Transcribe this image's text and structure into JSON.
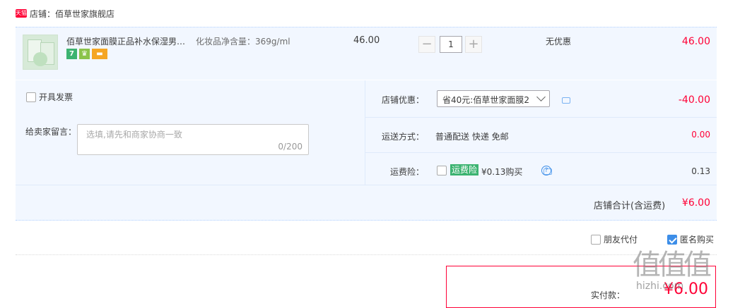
{
  "store": {
    "tag": "天猫",
    "label": "店铺：",
    "name": "佰草世家旗舰店"
  },
  "item": {
    "title": "佰草世家面膜正品补水保湿男女...",
    "sku": "化妆品净含量：369g/ml",
    "badges": [
      "7",
      "",
      ""
    ],
    "unit_price": "46.00",
    "quantity": "1",
    "promo": "无优惠",
    "total": "46.00"
  },
  "options": {
    "invoice_label": "开具发票",
    "message_label": "给卖家留言：",
    "message_placeholder": "选填,请先和商家协商一致",
    "message_count": "0/200",
    "coupon_label": "店铺优惠：",
    "coupon_selected": "省40元:佰草世家面膜2",
    "coupon_amount": "-40.00",
    "shipping_label": "运送方式：",
    "shipping_value": "普通配送 快递 免邮",
    "shipping_amount": "0.00",
    "insurance_label": "运费险：",
    "insurance_tag": "运费险",
    "insurance_price": "¥0.13购买",
    "insurance_amount": "0.13",
    "store_total_label": "店铺合计(含运费)",
    "store_total": "¥6.00"
  },
  "footer": {
    "friend_pay_label": "朋友代付",
    "friend_pay_checked": false,
    "anonymous_label": "匿名购买",
    "anonymous_checked": true,
    "pay_label": "实付款：",
    "pay_value": "¥6.00"
  },
  "watermark": {
    "text": "值值值",
    "sub": "hizhi.com"
  },
  "colors": {
    "accent": "#ff0036",
    "panel_bg": "#f2f7ff",
    "check_blue": "#3d8ee8",
    "insurance_green": "#3cb371"
  }
}
